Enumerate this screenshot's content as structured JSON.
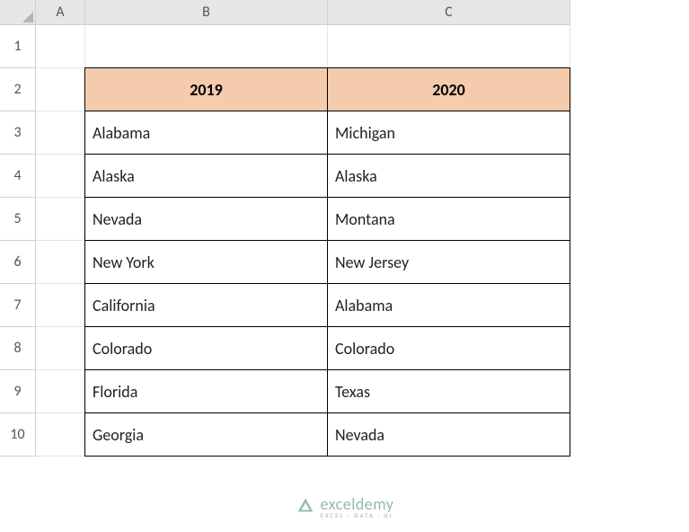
{
  "columns": [
    "A",
    "B",
    "C"
  ],
  "rows": [
    "1",
    "2",
    "3",
    "4",
    "5",
    "6",
    "7",
    "8",
    "9",
    "10"
  ],
  "chart_data": {
    "type": "table",
    "title": "",
    "headers": [
      "2019",
      "2020"
    ],
    "data": [
      [
        "Alabama",
        "Michigan"
      ],
      [
        "Alaska",
        "Alaska"
      ],
      [
        "Nevada",
        "Montana"
      ],
      [
        "New York",
        "New Jersey"
      ],
      [
        "California",
        "Alabama"
      ],
      [
        "Colorado",
        "Colorado"
      ],
      [
        "Florida",
        "Texas"
      ],
      [
        "Georgia",
        "Nevada"
      ]
    ]
  },
  "watermark": {
    "brand": "exceldemy",
    "tagline": "EXCEL · DATA · BI"
  }
}
